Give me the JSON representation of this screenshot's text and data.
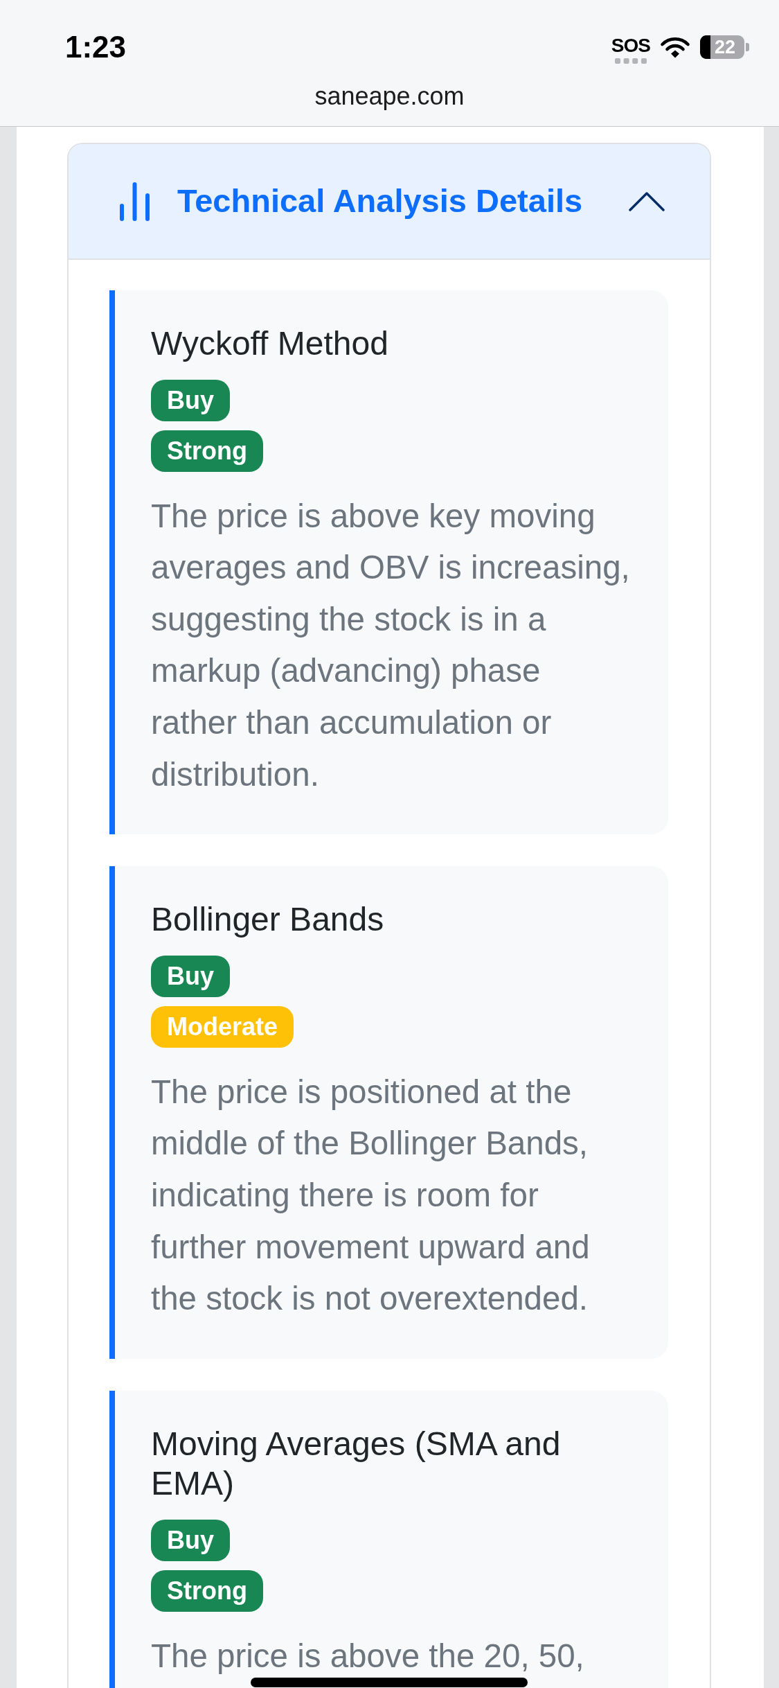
{
  "status_bar": {
    "time": "1:23",
    "carrier": "SOS",
    "battery": "22"
  },
  "browser": {
    "url": "saneape.com"
  },
  "panel": {
    "title": "Technical Analysis Details",
    "expanded": true,
    "items": [
      {
        "title": "Wyckoff Method",
        "badges": [
          {
            "label": "Buy",
            "color": "#198754"
          },
          {
            "label": "Strong",
            "color": "#198754"
          }
        ],
        "description": "The price is above key moving averages and OBV is increasing, suggesting the stock is in a markup (advancing) phase rather than accumulation or distribution."
      },
      {
        "title": "Bollinger Bands",
        "badges": [
          {
            "label": "Buy",
            "color": "#198754"
          },
          {
            "label": "Moderate",
            "color": "#ffc107"
          }
        ],
        "description": "The price is positioned at the middle of the Bollinger Bands, indicating there is room for further movement upward and the stock is not overextended."
      },
      {
        "title": "Moving Averages (SMA and EMA)",
        "badges": [
          {
            "label": "Buy",
            "color": "#198754"
          },
          {
            "label": "Strong",
            "color": "#198754"
          }
        ],
        "description": "The price is above the 20, 50,"
      }
    ]
  }
}
